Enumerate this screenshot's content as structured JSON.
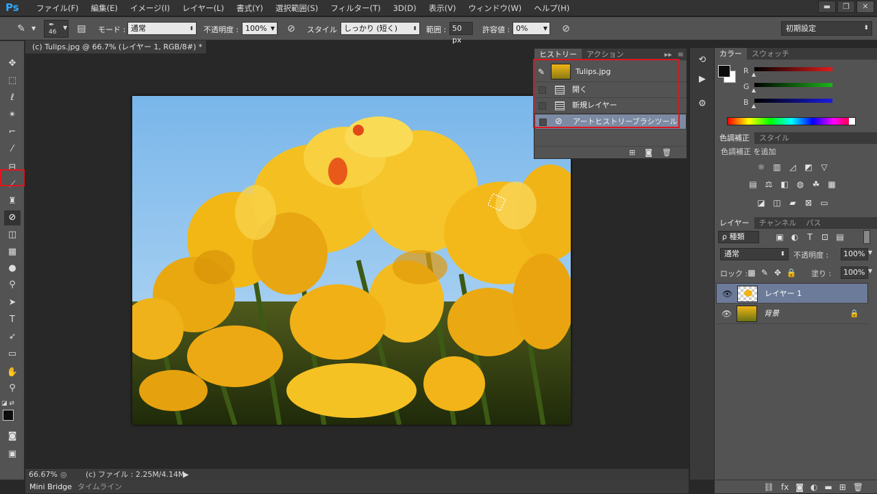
{
  "app": {
    "logo": "Ps"
  },
  "menu": [
    "ファイル(F)",
    "編集(E)",
    "イメージ(I)",
    "レイヤー(L)",
    "書式(Y)",
    "選択範囲(S)",
    "フィルター(T)",
    "3D(D)",
    "表示(V)",
    "ウィンドウ(W)",
    "ヘルプ(H)"
  ],
  "window_controls": {
    "minimize": "▬",
    "restore": "❐",
    "close": "✕"
  },
  "options": {
    "brush_size": "46",
    "mode_label": "モード :",
    "mode_value": "通常",
    "opacity_label": "不透明度 :",
    "opacity_value": "100%",
    "style_label": "スタイル :",
    "style_value": "しっかり (短く)",
    "area_label": "範囲 :",
    "area_value": "50 px",
    "tolerance_label": "許容値 :",
    "tolerance_value": "0%",
    "workspace": "初期設定"
  },
  "document": {
    "tab_title": "(c) Tulips.jpg @ 66.7% (レイヤー 1, RGB/8#) *",
    "close": "×",
    "zoom": "66.67%",
    "file_info": "(c) ファイル : 2.25M/4.14M"
  },
  "bottom_tabs": [
    "Mini Bridge",
    "タイムライン"
  ],
  "history_panel": {
    "tabs": [
      "ヒストリー",
      "アクション"
    ],
    "snapshot": "Tulips.jpg",
    "states": [
      "開く",
      "新規レイヤー",
      "アートヒストリーブラシツール"
    ],
    "selected_state": "アートヒストリーブラシツール"
  },
  "color_panel": {
    "tabs": [
      "カラー",
      "スウォッチ"
    ],
    "channels": [
      {
        "label": "R",
        "value": "0",
        "color": "#e01b1b"
      },
      {
        "label": "G",
        "value": "0",
        "color": "#1bb31b"
      },
      {
        "label": "B",
        "value": "0",
        "color": "#1b1be0"
      }
    ]
  },
  "adjustments_panel": {
    "tabs": [
      "色調補正",
      "スタイル"
    ],
    "add_label": "色調補正 を追加"
  },
  "layers_panel": {
    "tabs": [
      "レイヤー",
      "チャンネル",
      "パス"
    ],
    "filter_label": "ρ 種類",
    "blend_mode": "通常",
    "opacity_label": "不透明度 :",
    "opacity_value": "100%",
    "lock_label": "ロック :",
    "fill_label": "塗り :",
    "fill_value": "100%",
    "layers": [
      {
        "name": "レイヤー 1",
        "selected": true
      },
      {
        "name": "背景",
        "selected": false
      }
    ]
  },
  "colors": {
    "accent_highlight": "#e0141e",
    "selection": "#7d8aa3"
  }
}
